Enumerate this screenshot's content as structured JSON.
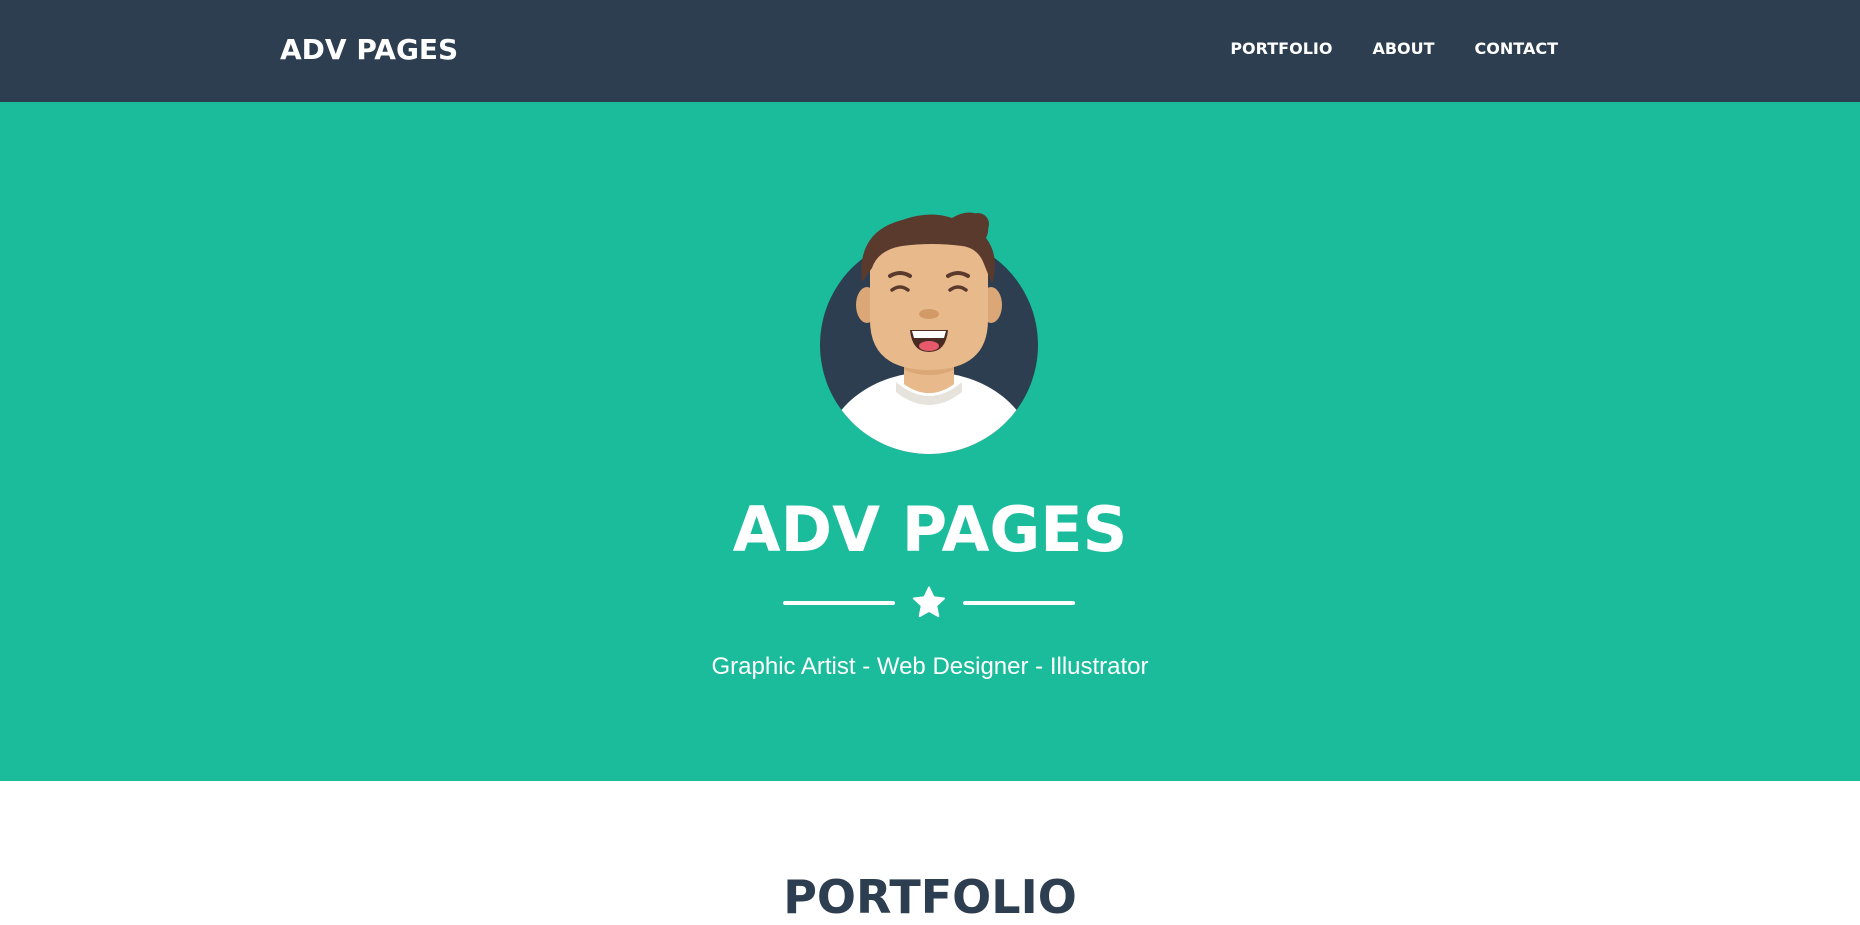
{
  "navbar": {
    "brand": "ADV PAGES",
    "links": [
      {
        "label": "PORTFOLIO"
      },
      {
        "label": "ABOUT"
      },
      {
        "label": "CONTACT"
      }
    ]
  },
  "masthead": {
    "avatar_icon": "avatar-icon",
    "title": "ADV PAGES",
    "divider_icon": "star-icon",
    "subtitle": "Graphic Artist - Web Designer - Illustrator"
  },
  "portfolio": {
    "heading": "PORTFOLIO"
  },
  "colors": {
    "navbar_bg": "#2c3e50",
    "hero_bg": "#1abc9c",
    "text_light": "#ffffff",
    "heading_dark": "#2c3e50"
  }
}
